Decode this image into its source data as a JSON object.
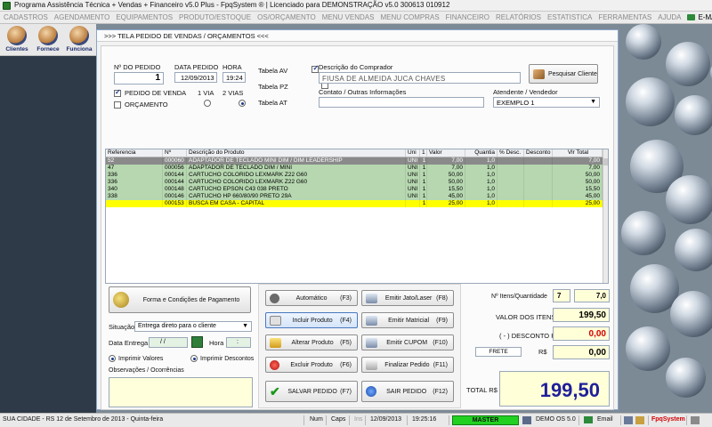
{
  "app": {
    "title": "Programa Assistência Técnica + Vendas + Financeiro v5.0 Plus - FpqSystem ® | Licenciado para  DEMONSTRAÇÃO v5.0 300613 010912"
  },
  "menu": {
    "items": [
      "CADASTROS",
      "AGENDAMENTO",
      "EQUIPAMENTOS",
      "PRODUTO/ESTOQUE",
      "OS/ORÇAMENTO",
      "MENU VENDAS",
      "MENU COMPRAS",
      "FINANCEIRO",
      "RELATÓRIOS",
      "ESTATISTICA",
      "FERRAMENTAS",
      "AJUDA"
    ],
    "email": "E-MAIL"
  },
  "toolbar": {
    "items": [
      "Clientes",
      "Fornece",
      "Funciona"
    ]
  },
  "window": {
    "title": ">>>  TELA PEDIDO DE VENDAS / ORÇAMENTOS  <<<"
  },
  "form": {
    "nro_pedido_label": "Nº DO PEDIDO",
    "nro_pedido": "1",
    "data_pedido_label": "DATA PEDIDO",
    "data_pedido": "12/09/2013",
    "hora_label": "HORA",
    "hora": "19:24",
    "pedido_venda_label": "PEDIDO DE VENDA",
    "orcamento_label": "ORÇAMENTO",
    "via1_label": "1 VIA",
    "via2_label": "2 VIAS",
    "tabela_av": "Tabela AV",
    "tabela_pz": "Tabela PZ",
    "tabela_at": "Tabela AT",
    "comprador_label": "Descrição do Comprador",
    "comprador": "FIUSA DE ALMEIDA JUCA CHAVES",
    "pesquisar_cliente": "Pesquisar Cliente",
    "contato_label": "Contato / Outras Informações",
    "contato": "",
    "atendente_label": "Atendente / Vendedor",
    "atendente": "EXEMPLO 1"
  },
  "grid": {
    "headers": [
      "Referencia",
      "Nº",
      "Descrição do Produto",
      "Uni",
      "1",
      "Valor",
      "Quantia",
      "% Desc.",
      "Desconto",
      "Vlr Total"
    ],
    "rows": [
      [
        "52",
        "000060",
        "ADAPTADOR  DE  TECLADO  MINI DIM / DIM  LEADERSHIP",
        "UNI",
        "1",
        "7,00",
        "1,0",
        "",
        "",
        "7,00"
      ],
      [
        "47",
        "000056",
        "ADAPTADOR  DE  TECLADO DIM / MINI",
        "UNI",
        "1",
        "7,00",
        "1,0",
        "",
        "",
        "7,00"
      ],
      [
        "336",
        "000144",
        "CARTUCHO COLORIDO LEXMARK Z22   G60",
        "UNI",
        "1",
        "50,00",
        "1,0",
        "",
        "",
        "50,00"
      ],
      [
        "336",
        "000144",
        "CARTUCHO COLORIDO LEXMARK Z22   G60",
        "UNI",
        "1",
        "50,00",
        "1,0",
        "",
        "",
        "50,00"
      ],
      [
        "340",
        "000148",
        "CARTUCHO EPSON C43 038 PRETO",
        "UNI",
        "1",
        "15,50",
        "1,0",
        "",
        "",
        "15,50"
      ],
      [
        "338",
        "000146",
        "CARTUCHO HP 660/80/90 PRETO 29A",
        "UNI",
        "1",
        "45,00",
        "1,0",
        "",
        "",
        "45,00"
      ],
      [
        "",
        "000153",
        "BUSCA EM CASA - CAPITAL",
        "",
        "1",
        "25,00",
        "1,0",
        "",
        "",
        "25,00"
      ]
    ]
  },
  "payment": {
    "forma_button": "Forma e Condições de Pagamento",
    "situacao_label": "Situação",
    "situacao": "Entrega direto para o cliente",
    "data_entrega_label": "Data Entrega",
    "data_entrega": "/ /",
    "hora_label": "Hora",
    "hora": ":",
    "imprimir_valores": "Imprimir Valores",
    "imprimir_descontos": "Imprimir Descontos",
    "observacoes_label": "Observações / Ocorrências",
    "observacoes": ""
  },
  "actions": {
    "automatico": "Automático",
    "automatico_key": "(F3)",
    "incluir": "Incluir Produto",
    "incluir_key": "(F4)",
    "alterar": "Alterar Produto",
    "alterar_key": "(F5)",
    "excluir": "Excluir Produto",
    "excluir_key": "(F6)",
    "salvar": "SALVAR PEDIDO",
    "salvar_key": "(F7)",
    "emitir_jato": "Emitir Jato/Laser",
    "emitir_jato_key": "(F8)",
    "emitir_matricial": "Emitir Matricial",
    "emitir_matricial_key": "(F9)",
    "emitir_cupom": "Emitir CUPOM",
    "emitir_cupom_key": "(F10)",
    "finalizar": "Finalizar Pedido",
    "finalizar_key": "(F11)",
    "sair": "SAIR  PEDIDO",
    "sair_key": "(F12)"
  },
  "totals": {
    "itens_label": "Nº Itens/Quantidade",
    "itens": "7",
    "quantidade": "7,0",
    "valor_itens_label": "VALOR DOS ITENS R$",
    "valor_itens": "199,50",
    "desconto_label": "( - ) DESCONTO R$",
    "desconto": "0,00",
    "frete_label": "FRETE",
    "frete_currency": "R$",
    "frete": "0,00",
    "total_label": "TOTAL R$",
    "total": "199,50"
  },
  "status": {
    "city": "SUA CIDADE - RS 12 de Setembro de 2013 - Quinta-feira",
    "num": "Num",
    "caps": "Caps",
    "ins": "Ins",
    "date": "12/09/2013",
    "time": "19:25:16",
    "master": "MASTER",
    "demo": "DEMO OS 5.0",
    "email": "Email",
    "brand": "FpqSystem"
  },
  "colors": {
    "row_selected": "#8a8a8a",
    "row_alt": "#b6d7b0",
    "row_yellow": "#ffff00",
    "value_red": "#d40000",
    "total_blue": "#1f1f9a",
    "total_bg": "#ffffd8"
  }
}
